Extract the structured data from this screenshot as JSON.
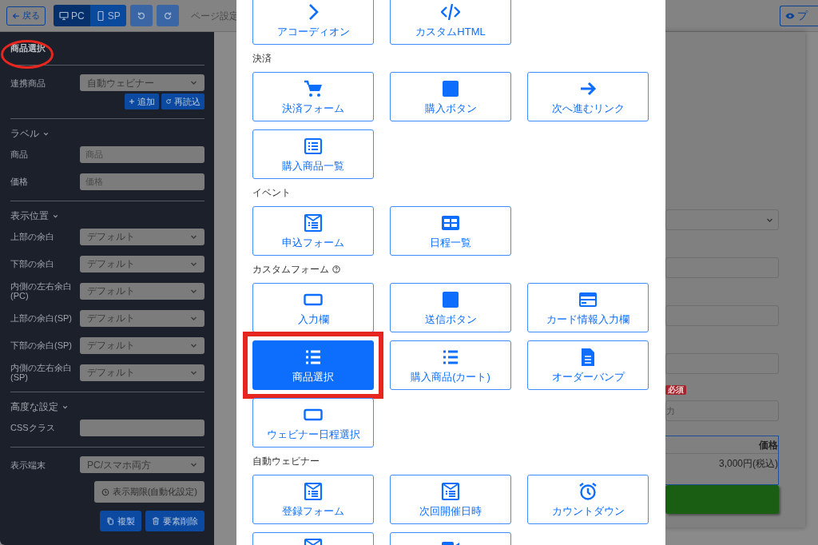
{
  "toolbar": {
    "back": "戻る",
    "device_tabs": [
      {
        "label": "PC",
        "selected": true
      },
      {
        "label": "SP",
        "selected": false
      }
    ],
    "page_settings": "ページ設定",
    "preview": "プ"
  },
  "sidebar": {
    "title": "商品選択",
    "linked": {
      "label": "連携商品",
      "value": "自動ウェビナー"
    },
    "link_buttons": [
      "追加",
      "再読込"
    ],
    "sections": [
      {
        "heading": "ラベル",
        "expanded": true,
        "rows": [
          {
            "kind": "input",
            "label": "商品",
            "placeholder": "商品"
          },
          {
            "kind": "input",
            "label": "価格",
            "placeholder": "価格"
          }
        ]
      },
      {
        "heading": "表示位置",
        "expanded": true,
        "rows": [
          {
            "kind": "select",
            "label": "上部の余白",
            "value": "デフォルト"
          },
          {
            "kind": "select",
            "label": "下部の余白",
            "value": "デフォルト"
          },
          {
            "kind": "select",
            "label": "内側の左右余白(PC)",
            "value": "デフォルト"
          },
          {
            "kind": "select",
            "label": "上部の余白(SP)",
            "value": "デフォルト"
          },
          {
            "kind": "select",
            "label": "下部の余白(SP)",
            "value": "デフォルト"
          },
          {
            "kind": "select",
            "label": "内側の左右余白(SP)",
            "value": "デフォルト"
          }
        ]
      },
      {
        "heading": "高度な設定",
        "expanded": true,
        "rows": [
          {
            "kind": "input",
            "label": "CSSクラス"
          }
        ]
      }
    ],
    "device": {
      "label": "表示端末",
      "value": "PC/スマホ両方"
    },
    "schedule_button": "表示期限(自動化設定)",
    "actions": [
      "複製",
      "要素削除"
    ]
  },
  "modal": {
    "groups": [
      {
        "tiles": [
          {
            "kind": "chevron",
            "label": "アコーディオン",
            "selected": false
          },
          {
            "kind": "code",
            "label": "カスタムHTML",
            "selected": false
          }
        ]
      },
      {
        "heading": "決済",
        "tiles": [
          {
            "kind": "cart",
            "label": "決済フォーム",
            "selected": false
          },
          {
            "kind": "square",
            "label": "購入ボタン",
            "selected": false
          },
          {
            "kind": "arrow",
            "label": "次へ進むリンク",
            "selected": false
          },
          {
            "kind": "listbox",
            "label": "購入商品一覧",
            "selected": false
          }
        ]
      },
      {
        "heading": "イベント",
        "tiles": [
          {
            "kind": "form",
            "label": "申込フォーム",
            "selected": false
          },
          {
            "kind": "grid",
            "label": "日程一覧",
            "selected": false
          }
        ]
      },
      {
        "heading": "カスタムフォーム",
        "help": true,
        "tiles": [
          {
            "kind": "field",
            "label": "入力欄",
            "selected": false
          },
          {
            "kind": "square",
            "label": "送信ボタン",
            "selected": false
          },
          {
            "kind": "card",
            "label": "カード情報入力欄",
            "selected": false
          },
          {
            "kind": "list",
            "label": "商品選択",
            "selected": true
          },
          {
            "kind": "list",
            "label": "購入商品(カート)",
            "selected": false
          },
          {
            "kind": "file",
            "label": "オーダーバンプ",
            "selected": false
          },
          {
            "kind": "field",
            "label": "ウェビナー日程選択",
            "selected": false
          }
        ]
      },
      {
        "heading": "自動ウェビナー",
        "tiles": [
          {
            "kind": "form",
            "label": "登録フォーム",
            "selected": false
          },
          {
            "kind": "form",
            "label": "次回開催日時",
            "selected": false
          },
          {
            "kind": "clock",
            "label": "カウントダウン",
            "selected": false
          },
          {
            "kind": "form",
            "selected": false
          },
          {
            "kind": "video",
            "selected": false
          }
        ]
      }
    ]
  },
  "preview": {
    "badge": "必須",
    "input_placeholder": "力",
    "table_header": "価格",
    "table_value": "3,000円(税込)"
  }
}
